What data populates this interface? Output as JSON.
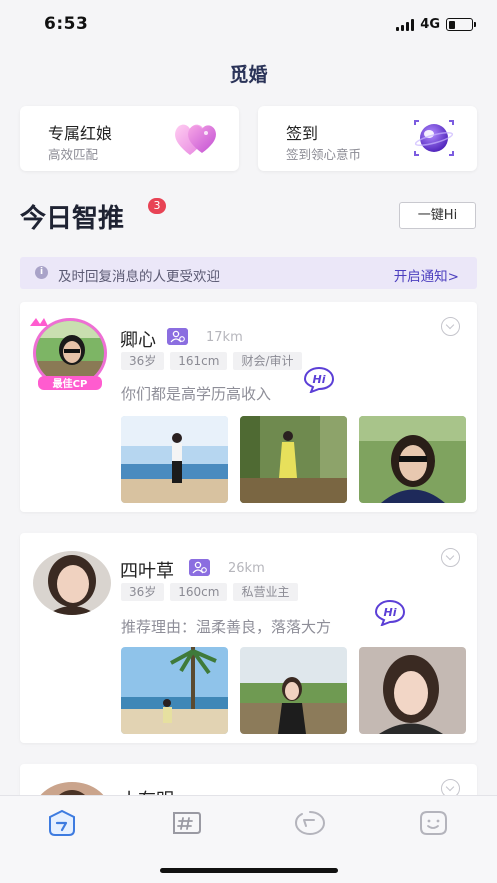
{
  "status_bar": {
    "time": "6:53",
    "network": "4G"
  },
  "header": {
    "title": "觅婚"
  },
  "features": [
    {
      "title": "专属红娘",
      "subtitle": "高效匹配",
      "icon": "hearts-icon"
    },
    {
      "title": "签到",
      "subtitle": "签到领心意币",
      "icon": "planet-icon"
    }
  ],
  "section": {
    "title": "今日智推",
    "badge": "3",
    "hi_all_label": "一键Hi"
  },
  "notice": {
    "icon": "info-icon",
    "text": "及时回复消息的人更受欢迎",
    "link": "开启通知>"
  },
  "profiles": [
    {
      "name": "卿心",
      "distance": "17km",
      "tags": [
        "36岁",
        "161cm",
        "财会/审计"
      ],
      "bio": "你们都是高学历高收入",
      "hi_label": "Hi",
      "avatar_frame_text": "最佳CP"
    },
    {
      "name": "四叶草",
      "distance": "26km",
      "tags": [
        "36岁",
        "160cm",
        "私营业主"
      ],
      "bio": "推荐理由：温柔善良，落落大方",
      "hi_label": "Hi"
    },
    {
      "name": "小有明"
    }
  ],
  "tab_bar": {
    "tabs": [
      {
        "icon": "home-icon",
        "active": true
      },
      {
        "icon": "hashtag-icon",
        "active": false
      },
      {
        "icon": "message-icon",
        "active": false
      },
      {
        "icon": "profile-face-icon",
        "active": false
      }
    ]
  },
  "colors": {
    "accent": "#4c3fbf",
    "verify": "#8b6ee0",
    "badge": "#e84355",
    "active_tab": "#3d7be0"
  }
}
